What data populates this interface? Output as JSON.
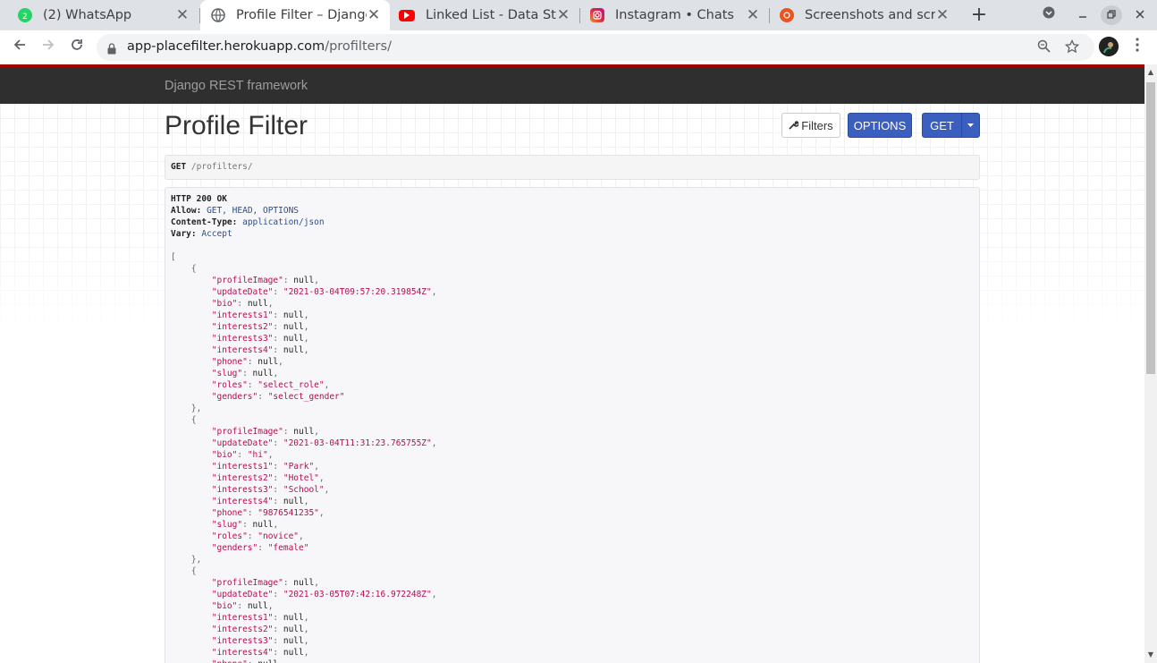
{
  "browser": {
    "tabs": [
      {
        "title": "(2) WhatsApp",
        "icon": "whatsapp-icon",
        "active": false
      },
      {
        "title": "Profile Filter – Django REST framework",
        "icon": "globe-icon",
        "active": true
      },
      {
        "title": "Linked List - Data Structure",
        "icon": "youtube-icon",
        "active": false
      },
      {
        "title": "Instagram • Chats",
        "icon": "instagram-icon",
        "active": false
      },
      {
        "title": "Screenshots and screencasts",
        "icon": "ubuntu-icon",
        "active": false
      }
    ],
    "new_tab_label": "+",
    "url_host": "app-placefilter.herokuapp.com",
    "url_path": "/profilters/"
  },
  "navbar": {
    "brand": "Django REST framework"
  },
  "page": {
    "title": "Profile Filter",
    "buttons": {
      "filters": "Filters",
      "options": "OPTIONS",
      "get": "GET"
    },
    "request": {
      "method": "GET",
      "path": "/profilters/"
    },
    "response_headers": [
      {
        "name": "HTTP 200 OK",
        "value": ""
      },
      {
        "name": "Allow:",
        "value": "GET, HEAD, OPTIONS"
      },
      {
        "name": "Content-Type:",
        "value": "application/json"
      },
      {
        "name": "Vary:",
        "value": "Accept"
      }
    ],
    "profiles": [
      {
        "profileImage": null,
        "updateDate": "2021-03-04T09:57:20.319854Z",
        "bio": null,
        "interests1": null,
        "interests2": null,
        "interests3": null,
        "interests4": null,
        "phone": null,
        "slug": null,
        "roles": "select_role",
        "genders": "select_gender"
      },
      {
        "profileImage": null,
        "updateDate": "2021-03-04T11:31:23.765755Z",
        "bio": "hi",
        "interests1": "Park",
        "interests2": "Hotel",
        "interests3": "School",
        "interests4": null,
        "phone": "9876541235",
        "slug": null,
        "roles": "novice",
        "genders": "female"
      },
      {
        "profileImage": null,
        "updateDate": "2021-03-05T07:42:16.972248Z",
        "bio": null,
        "interests1": null,
        "interests2": null,
        "interests3": null,
        "interests4": null,
        "phone": null
      }
    ]
  },
  "colors": {
    "navbar": "#2f2f2f",
    "accent_line": "#a30000",
    "primary_button": "#3a5fbf",
    "json_key": "#b50d52"
  }
}
